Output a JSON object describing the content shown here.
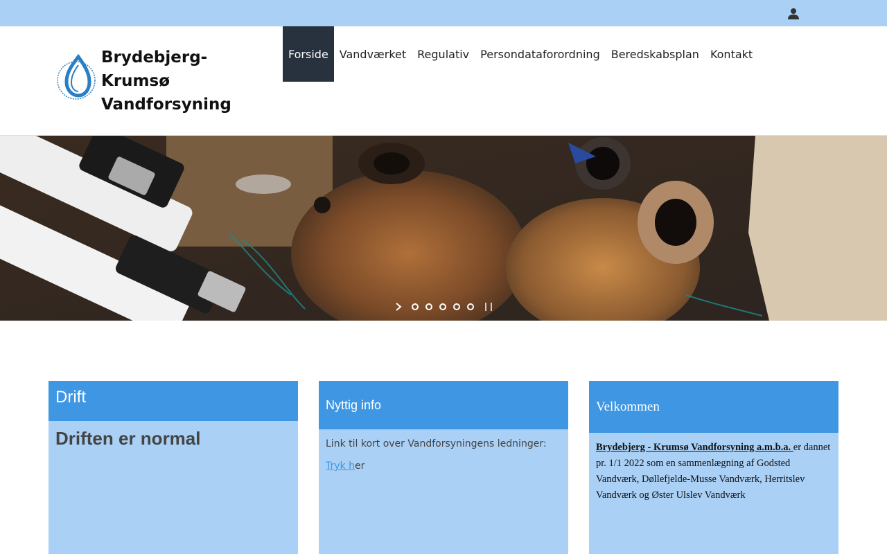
{
  "topbar": {
    "icon": "user-icon"
  },
  "logo": {
    "lines": [
      "Brydebjerg-",
      "Krumsø",
      "Vandforsyning"
    ],
    "ring_text": "Medlem af Danske Vandværker",
    "colors": {
      "drop": "#2a7fc4"
    }
  },
  "nav": {
    "items": [
      {
        "label": "Forside",
        "active": true
      },
      {
        "label": "Vandværket"
      },
      {
        "label": "Regulativ"
      },
      {
        "label": "Persondataforordning"
      },
      {
        "label": "Beredskabsplan"
      },
      {
        "label": "Kontakt"
      }
    ]
  },
  "hero": {
    "slide_count": 5,
    "controls": {
      "next_icon": "chevron-right-icon",
      "pause_icon": "pause-icon"
    }
  },
  "cards": {
    "drift": {
      "title": "Drift",
      "status": "Driften er normal"
    },
    "nyttig": {
      "title": "Nyttig info",
      "text": "Link til kort over Vandforsyningens ledninger:",
      "link_part": "Tryk h",
      "rest_part": "er"
    },
    "velkommen": {
      "title": "Velkommen",
      "org": "Brydebjerg - Krumsø Vandforsyning a.m.b.a. ",
      "body": " er dannet pr. 1/1 2022 som en sammenlægning af Godsted Vandværk, Døllefjelde-Musse Vandværk, Herritslev Vandværk og Øster Ulslev Vandværk"
    }
  },
  "colors": {
    "topbar": "#aad0f5",
    "nav_active": "#28323f",
    "card_head": "#3f96e3",
    "card_body": "#aad0f5"
  }
}
